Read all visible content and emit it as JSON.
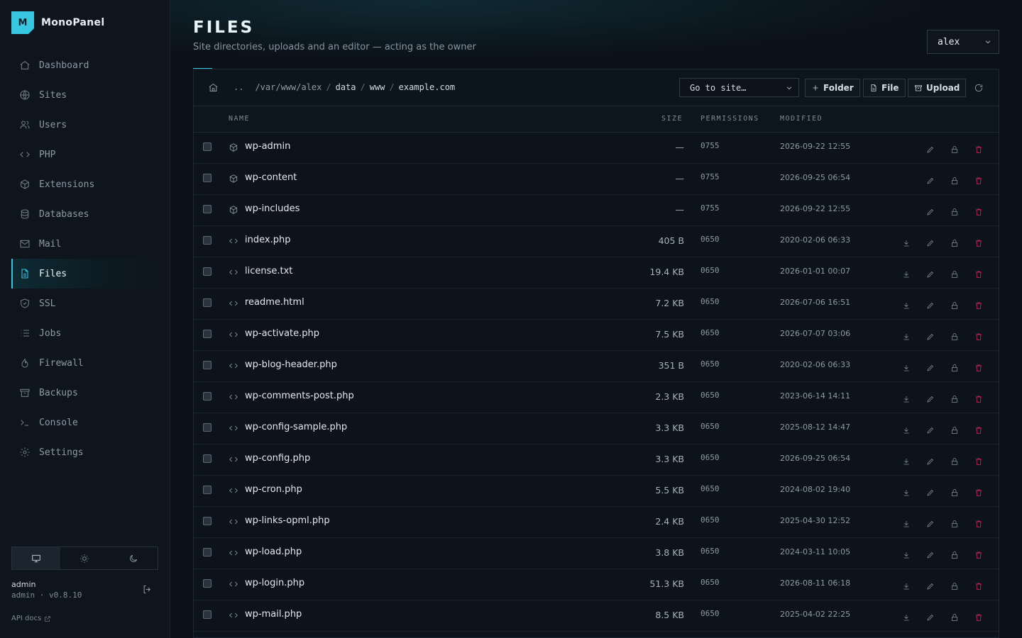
{
  "brand": {
    "logo_letter": "M",
    "name": "MonoPanel"
  },
  "nav": [
    {
      "label": "Dashboard",
      "icon": "home-icon"
    },
    {
      "label": "Sites",
      "icon": "globe-icon"
    },
    {
      "label": "Users",
      "icon": "users-icon"
    },
    {
      "label": "PHP",
      "icon": "code-icon"
    },
    {
      "label": "Extensions",
      "icon": "box-icon"
    },
    {
      "label": "Databases",
      "icon": "database-icon"
    },
    {
      "label": "Mail",
      "icon": "mail-icon"
    },
    {
      "label": "Files",
      "icon": "file-icon",
      "active": true
    },
    {
      "label": "SSL",
      "icon": "shield-icon"
    },
    {
      "label": "Jobs",
      "icon": "list-icon"
    },
    {
      "label": "Firewall",
      "icon": "flame-icon"
    },
    {
      "label": "Backups",
      "icon": "archive-icon"
    },
    {
      "label": "Console",
      "icon": "terminal-icon"
    },
    {
      "label": "Settings",
      "icon": "gear-icon"
    }
  ],
  "theme": {
    "options": [
      "monitor-icon",
      "sun-icon",
      "moon-icon"
    ],
    "active": "monitor-icon"
  },
  "user": {
    "name": "admin",
    "meta": "admin · v0.8.10"
  },
  "api_docs": "API docs",
  "header": {
    "title": "FILES",
    "subtitle": "Site directories, uploads and an editor — acting as the owner",
    "account": "alex"
  },
  "toolbar": {
    "up": "..",
    "path_root": "/var/www/alex",
    "path_parts": [
      "data",
      "www",
      "example.com"
    ],
    "goto_label": "Go to site…",
    "folder_label": "Folder",
    "file_label": "File",
    "upload_label": "Upload"
  },
  "columns": {
    "name": "NAME",
    "size": "SIZE",
    "permissions": "PERMISSIONS",
    "modified": "MODIFIED"
  },
  "files": [
    {
      "name": "wp-admin",
      "type": "folder",
      "size": "—",
      "perm": "0755",
      "modified": "2026-09-22 12:55"
    },
    {
      "name": "wp-content",
      "type": "folder",
      "size": "—",
      "perm": "0755",
      "modified": "2026-09-25 06:54"
    },
    {
      "name": "wp-includes",
      "type": "folder",
      "size": "—",
      "perm": "0755",
      "modified": "2026-09-22 12:55"
    },
    {
      "name": "index.php",
      "type": "file",
      "size": "405 B",
      "perm": "0650",
      "modified": "2020-02-06 06:33"
    },
    {
      "name": "license.txt",
      "type": "file",
      "size": "19.4 KB",
      "perm": "0650",
      "modified": "2026-01-01 00:07"
    },
    {
      "name": "readme.html",
      "type": "file",
      "size": "7.2 KB",
      "perm": "0650",
      "modified": "2026-07-06 16:51"
    },
    {
      "name": "wp-activate.php",
      "type": "file",
      "size": "7.5 KB",
      "perm": "0650",
      "modified": "2026-07-07 03:06"
    },
    {
      "name": "wp-blog-header.php",
      "type": "file",
      "size": "351 B",
      "perm": "0650",
      "modified": "2020-02-06 06:33"
    },
    {
      "name": "wp-comments-post.php",
      "type": "file",
      "size": "2.3 KB",
      "perm": "0650",
      "modified": "2023-06-14 14:11"
    },
    {
      "name": "wp-config-sample.php",
      "type": "file",
      "size": "3.3 KB",
      "perm": "0650",
      "modified": "2025-08-12 14:47"
    },
    {
      "name": "wp-config.php",
      "type": "file",
      "size": "3.3 KB",
      "perm": "0650",
      "modified": "2026-09-25 06:54"
    },
    {
      "name": "wp-cron.php",
      "type": "file",
      "size": "5.5 KB",
      "perm": "0650",
      "modified": "2024-08-02 19:40"
    },
    {
      "name": "wp-links-opml.php",
      "type": "file",
      "size": "2.4 KB",
      "perm": "0650",
      "modified": "2025-04-30 12:52"
    },
    {
      "name": "wp-load.php",
      "type": "file",
      "size": "3.8 KB",
      "perm": "0650",
      "modified": "2024-03-11 10:05"
    },
    {
      "name": "wp-login.php",
      "type": "file",
      "size": "51.3 KB",
      "perm": "0650",
      "modified": "2026-08-11 06:18"
    },
    {
      "name": "wp-mail.php",
      "type": "file",
      "size": "8.5 KB",
      "perm": "0650",
      "modified": "2025-04-02 22:25"
    }
  ],
  "colors": {
    "accent": "#37c7e0",
    "danger": "#e0245e",
    "bg": "#0b1118"
  }
}
